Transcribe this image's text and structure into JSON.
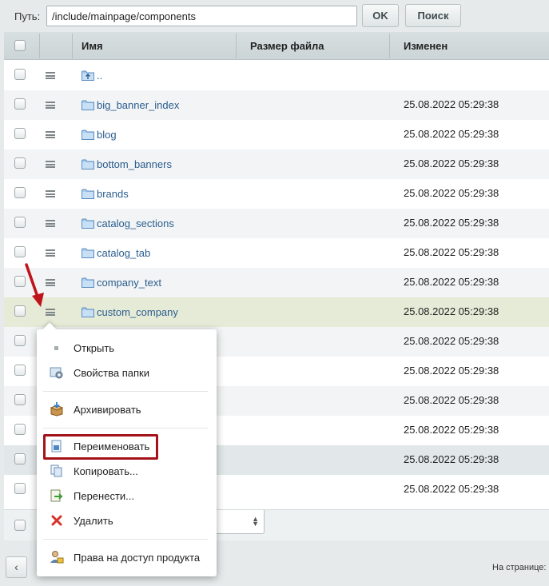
{
  "path": {
    "label": "Путь:",
    "value": "/include/mainpage/components"
  },
  "buttons": {
    "ok": "OK",
    "search": "Поиск"
  },
  "columns": {
    "name": "Имя",
    "size": "Размер файла",
    "modified": "Изменен"
  },
  "rows": [
    {
      "name": "..",
      "date": ""
    },
    {
      "name": "big_banner_index",
      "date": "25.08.2022 05:29:38"
    },
    {
      "name": "blog",
      "date": "25.08.2022 05:29:38"
    },
    {
      "name": "bottom_banners",
      "date": "25.08.2022 05:29:38"
    },
    {
      "name": "brands",
      "date": "25.08.2022 05:29:38"
    },
    {
      "name": "catalog_sections",
      "date": "25.08.2022 05:29:38"
    },
    {
      "name": "catalog_tab",
      "date": "25.08.2022 05:29:38"
    },
    {
      "name": "company_text",
      "date": "25.08.2022 05:29:38"
    },
    {
      "name": "custom_company",
      "date": "25.08.2022 05:29:38"
    },
    {
      "name": "",
      "date": "25.08.2022 05:29:38"
    },
    {
      "name": "",
      "date": "25.08.2022 05:29:38"
    },
    {
      "name": "",
      "date": "25.08.2022 05:29:38"
    },
    {
      "name": "",
      "date": "25.08.2022 05:29:38"
    },
    {
      "name": "",
      "date": "25.08.2022 05:29:38"
    },
    {
      "name": "",
      "date": "25.08.2022 05:29:38"
    }
  ],
  "context_menu": {
    "open": "Открыть",
    "folder_properties": "Свойства папки",
    "archive": "Архивировать",
    "rename": "Переименовать",
    "copy": "Копировать...",
    "move": "Перенести...",
    "delete": "Удалить",
    "access": "Права на доступ продукта"
  },
  "footer": {
    "per_page_label": "На странице:",
    "prev": "‹"
  },
  "colors": {
    "highlight_row": "#e6ebd7",
    "link": "#2a5d8f",
    "annotation_red": "#a3131a"
  }
}
